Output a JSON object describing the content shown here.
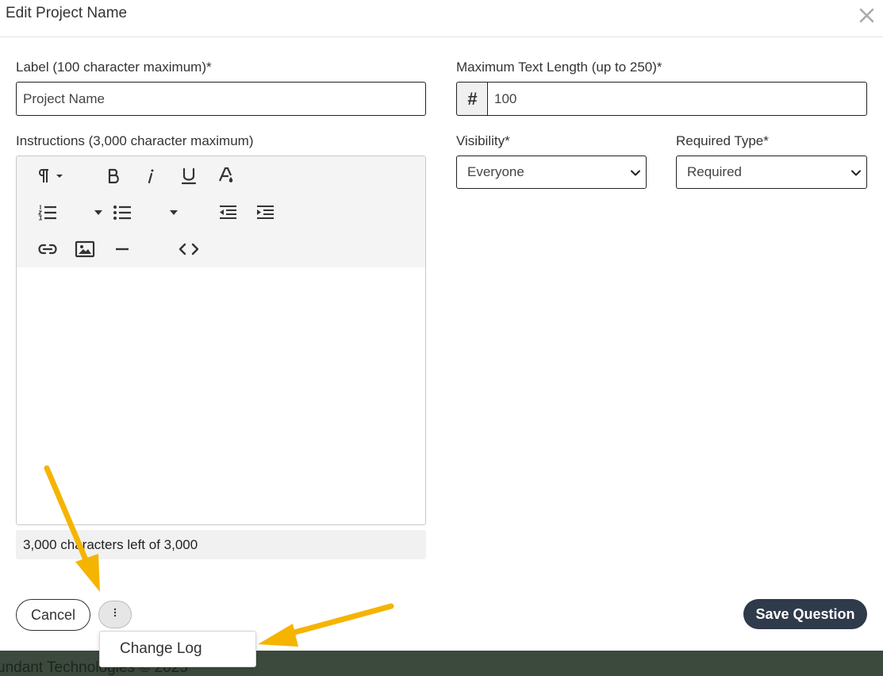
{
  "modal": {
    "title": "Edit Project Name"
  },
  "label_field": {
    "label": "Label (100 character maximum)*",
    "value": "Project Name"
  },
  "max_length_field": {
    "label": "Maximum Text Length (up to 250)*",
    "addon": "#",
    "value": "100"
  },
  "instructions_field": {
    "label": "Instructions (3,000 character maximum)",
    "counter": "3,000 characters left of 3,000"
  },
  "visibility_field": {
    "label": "Visibility*",
    "selected": "Everyone"
  },
  "required_field": {
    "label": "Required Type*",
    "selected": "Required"
  },
  "buttons": {
    "cancel": "Cancel",
    "save": "Save Question"
  },
  "more_menu": {
    "items": [
      "Change Log"
    ]
  },
  "footer": {
    "text": "undant Technologies © 2025"
  },
  "colors": {
    "save_button_bg": "#2f3a4a",
    "annotation_arrow": "#f5b400",
    "footer_bg": "#3c4a3e"
  }
}
